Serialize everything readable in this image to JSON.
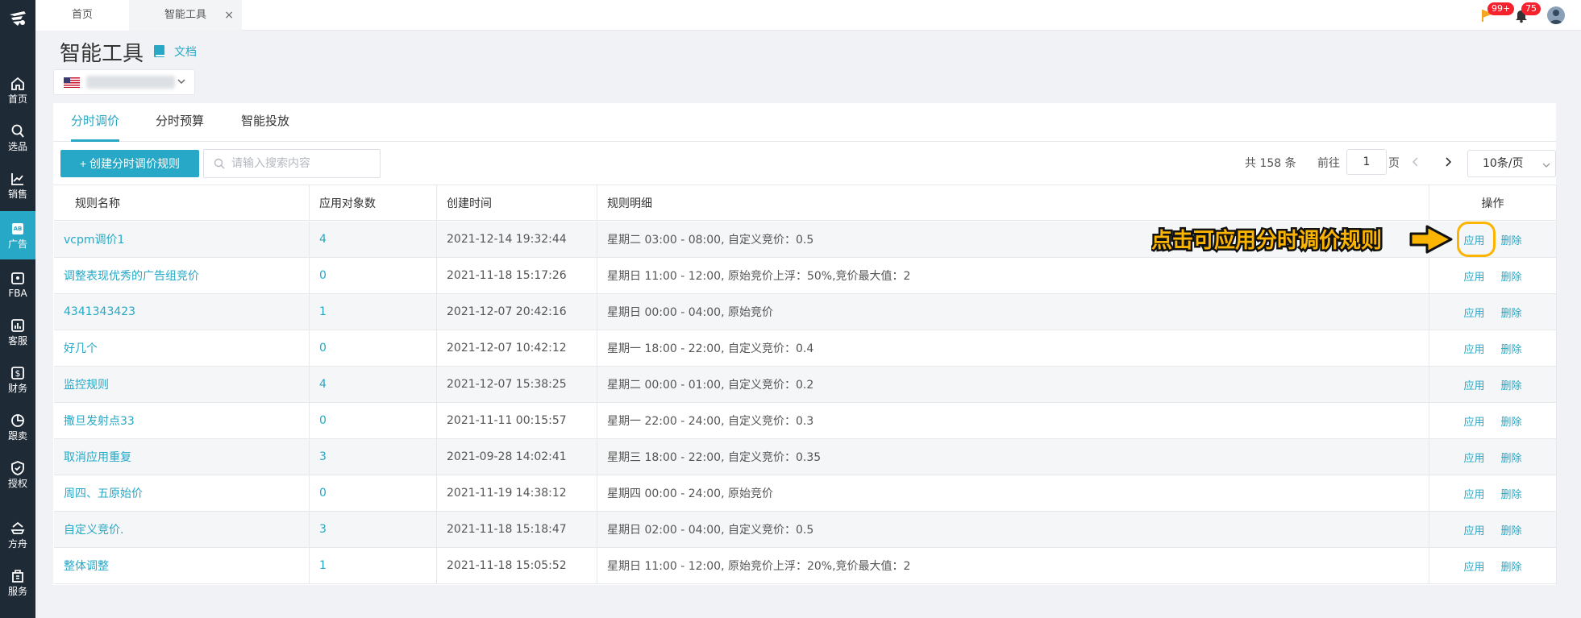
{
  "nav": {
    "items": [
      {
        "label": "首页"
      },
      {
        "label": "选品"
      },
      {
        "label": "销售"
      },
      {
        "label": "广告"
      },
      {
        "label": "FBA"
      },
      {
        "label": "客服"
      },
      {
        "label": "财务"
      },
      {
        "label": "跟卖"
      },
      {
        "label": "授权"
      },
      {
        "label": "方舟"
      },
      {
        "label": "服务"
      }
    ],
    "active": "广告",
    "accent": "#26a8c6",
    "background": "#1f2a37"
  },
  "tabs": [
    {
      "label": "首页"
    },
    {
      "label": "智能工具",
      "close": "×"
    }
  ],
  "top_icons": {
    "flag_badge": "99+",
    "bell_badge": "75"
  },
  "header": {
    "title": "智能工具",
    "doc_link": "文档"
  },
  "sub_tabs": [
    "分时调价",
    "分时预算",
    "智能投放"
  ],
  "toolbar": {
    "create_button": "+ 创建分时调价规则",
    "search_placeholder": "请输入搜索内容"
  },
  "pager": {
    "total": "共 158 条",
    "goto_prefix": "前往",
    "page": "1",
    "goto_suffix": "页",
    "page_size": "10条/页"
  },
  "table": {
    "columns": [
      "规则名称",
      "应用对象数",
      "创建时间",
      "规则明细",
      "操作"
    ],
    "action_apply": "应用",
    "action_delete": "删除",
    "rows": [
      {
        "name": "vcpm调价1",
        "count": "4",
        "created": "2021-12-14 19:32:44",
        "detail": "星期二 03:00 - 08:00, 自定义竞价：0.5"
      },
      {
        "name": "调整表现优秀的广告组竞价",
        "count": "0",
        "created": "2021-11-18 15:17:26",
        "detail": "星期日 11:00 - 12:00, 原始竞价上浮：50%,竞价最大值：2"
      },
      {
        "name": "4341343423",
        "count": "1",
        "created": "2021-12-07 20:42:16",
        "detail": "星期日 00:00 - 04:00, 原始竞价"
      },
      {
        "name": "好几个",
        "count": "0",
        "created": "2021-12-07 10:42:12",
        "detail": "星期一 18:00 - 22:00, 自定义竞价：0.4"
      },
      {
        "name": "监控规则",
        "count": "4",
        "created": "2021-12-07 15:38:25",
        "detail": "星期二 00:00 - 01:00, 自定义竞价：0.2"
      },
      {
        "name": "撒旦发射点33",
        "count": "0",
        "created": "2021-11-11 00:15:57",
        "detail": "星期一 22:00 - 24:00, 自定义竞价：0.3"
      },
      {
        "name": "取消应用重复",
        "count": "3",
        "created": "2021-09-28 14:02:41",
        "detail": "星期三 18:00 - 22:00, 自定义竞价：0.35"
      },
      {
        "name": "周四、五原始价",
        "count": "0",
        "created": "2021-11-19 14:38:12",
        "detail": "星期四 00:00 - 24:00, 原始竞价"
      },
      {
        "name": "自定义竞价.",
        "count": "3",
        "created": "2021-11-18 15:18:47",
        "detail": "星期日 02:00 - 04:00, 自定义竞价：0.5"
      },
      {
        "name": "整体调整",
        "count": "1",
        "created": "2021-11-18 15:05:52",
        "detail": "星期日 11:00 - 12:00, 原始竞价上浮：20%,竞价最大值：2"
      }
    ]
  },
  "annotation": {
    "text": "点击可应用分时调价规则",
    "color": "#fbb400"
  }
}
